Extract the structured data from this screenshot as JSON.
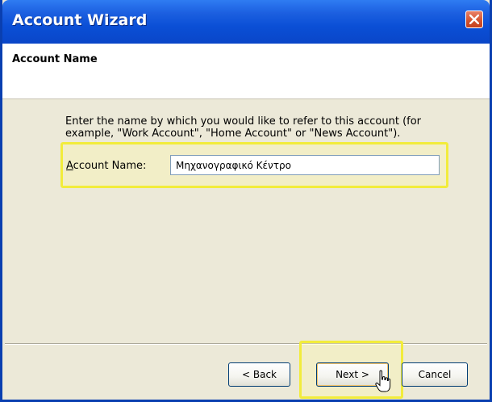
{
  "window": {
    "title": "Account Wizard",
    "close_icon": "close-icon"
  },
  "header": {
    "title": "Account Name"
  },
  "content": {
    "description": "Enter the name by which you would like to refer to this account (for example, \"Work Account\", \"Home Account\" or \"News Account\").",
    "field_label_accesskey": "A",
    "field_label_rest": "ccount Name:",
    "field_value": "Μηχανογραφικό Κέντρο"
  },
  "buttons": {
    "back": "< Back",
    "next": "Next >",
    "cancel": "Cancel"
  },
  "colors": {
    "titlebar": "#0b4fd6",
    "highlight": "#f2ec3b",
    "dialog_bg": "#ece9d8"
  },
  "cursor_icon": "pointer-hand-icon"
}
